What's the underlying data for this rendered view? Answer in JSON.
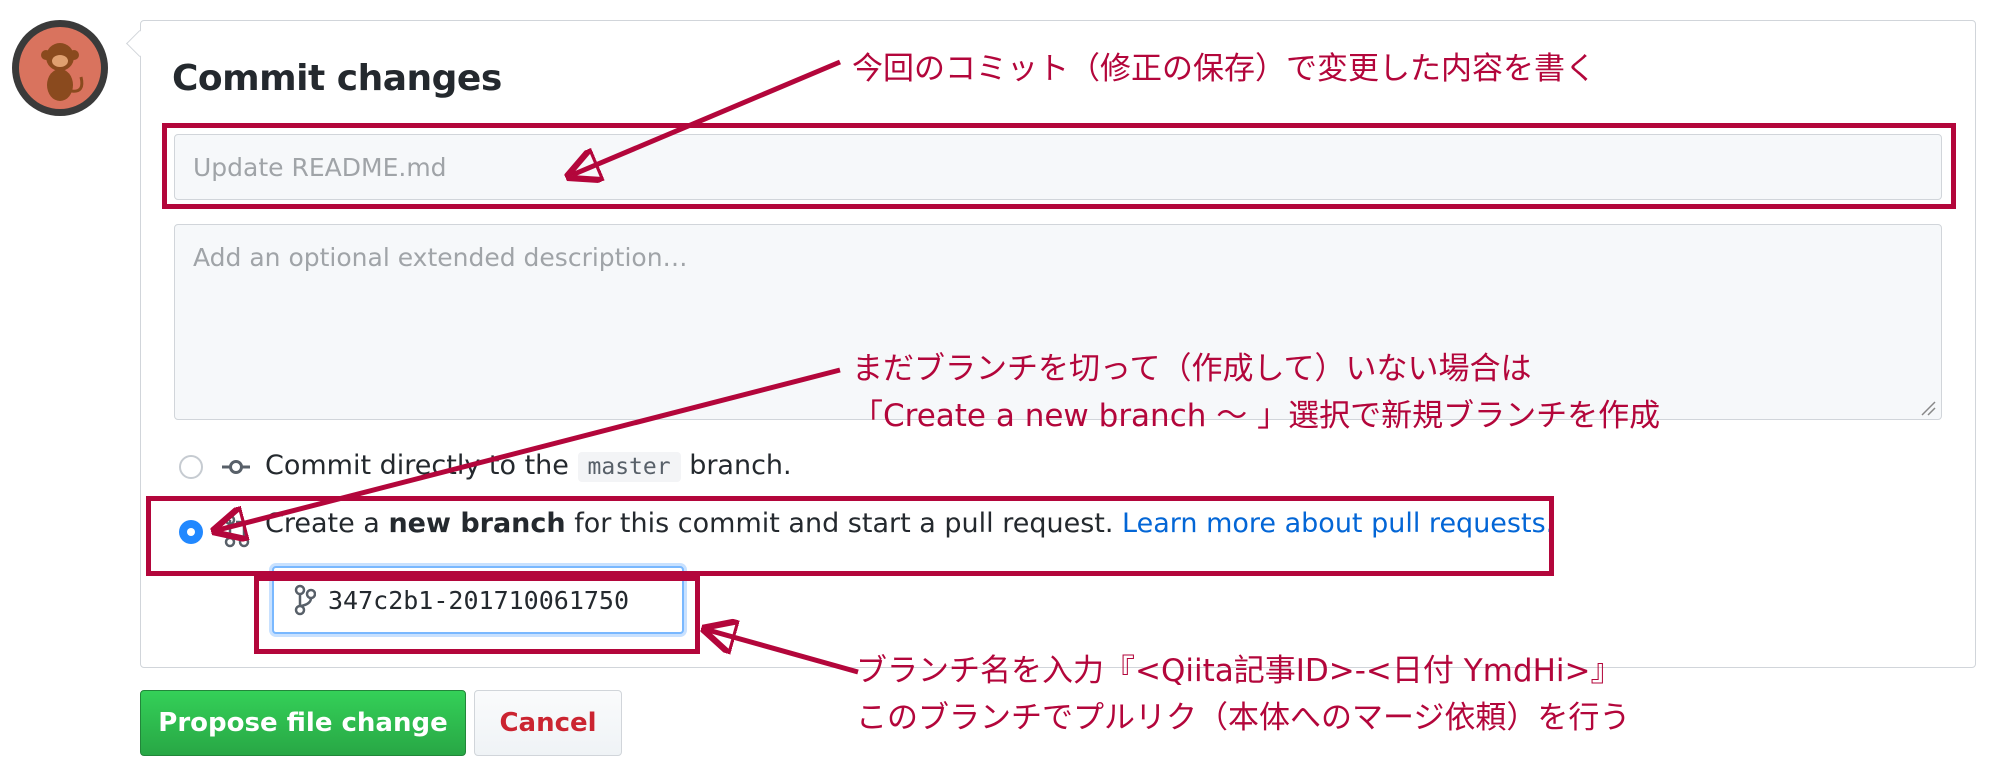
{
  "form": {
    "title": "Commit changes",
    "summary_placeholder": "Update README.md",
    "description_placeholder": "Add an optional extended description…",
    "option_direct": {
      "prefix": "Commit directly to the",
      "branch_code": "master",
      "suffix": "branch.",
      "selected": false
    },
    "option_new_branch": {
      "prefix": "Create a",
      "bold": "new branch",
      "middle": "for this commit and start a pull request.",
      "link": "Learn more about pull requests.",
      "selected": true
    },
    "branch_name_value": "347c2b1-201710061750",
    "propose_button": "Propose file change",
    "cancel_button": "Cancel"
  },
  "annotations": {
    "note1": "今回のコミット（修正の保存）で変更した内容を書く",
    "note2_line1": "まだブランチを切って（作成して）いない場合は",
    "note2_line2": "「Create a new branch 〜 」選択で新規ブランチを作成",
    "note3_line1": "ブランチ名を入力『<Qiita記事ID>-<日付 YmdHi>』",
    "note3_line2": "このブランチでプルリク（本体へのマージ依頼）を行う"
  },
  "colors": {
    "annotation": "#b3063b",
    "primary_button": "#28a745",
    "link": "#0366d6",
    "radio_selected": "#2188ff"
  },
  "icons": [
    "avatar-monkey",
    "commit-icon",
    "pull-request-icon",
    "git-branch-icon"
  ]
}
